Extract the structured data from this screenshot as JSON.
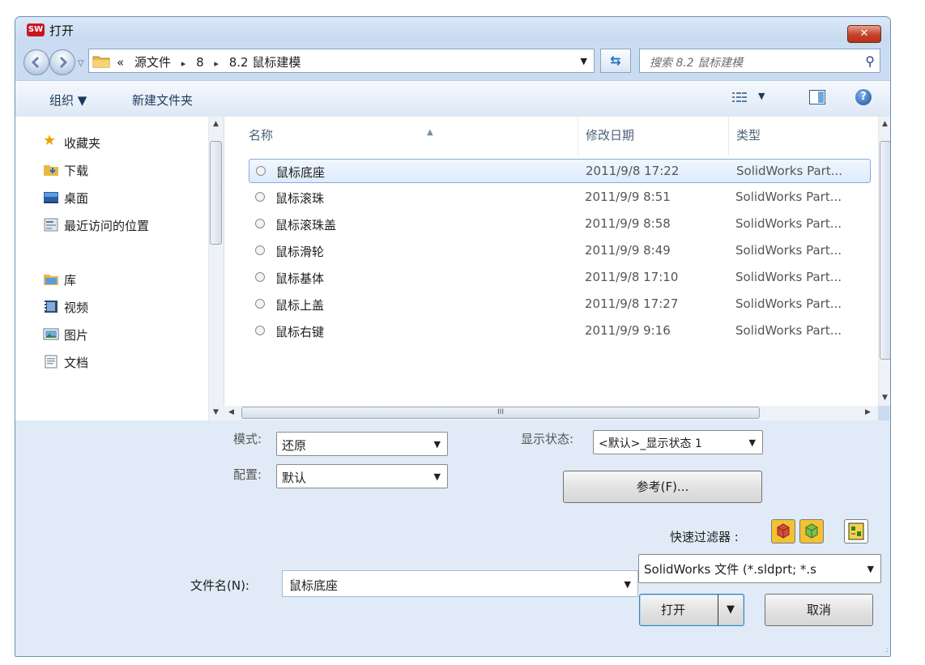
{
  "window": {
    "title": "打开",
    "close_label": "✕",
    "logo_text": "SW"
  },
  "nav": {
    "breadcrumbs": [
      "«",
      "源文件",
      "▸",
      "8",
      "▸",
      "8.2 鼠标建模"
    ],
    "search_placeholder": "搜索 8.2 鼠标建模"
  },
  "toolbar": {
    "organize": "组织 ▼",
    "new_folder": "新建文件夹"
  },
  "sidebar": {
    "items": [
      {
        "label": "收藏夹",
        "icon": "star-icon"
      },
      {
        "label": "下载",
        "icon": "download-folder-icon"
      },
      {
        "label": "桌面",
        "icon": "desktop-icon"
      },
      {
        "label": "最近访问的位置",
        "icon": "recent-places-icon"
      },
      {
        "label": "库",
        "icon": "library-icon"
      },
      {
        "label": "视频",
        "icon": "video-icon"
      },
      {
        "label": "图片",
        "icon": "pictures-icon"
      },
      {
        "label": "文档",
        "icon": "documents-icon"
      }
    ]
  },
  "files": {
    "columns": [
      "名称",
      "修改日期",
      "类型"
    ],
    "rows": [
      {
        "name": "鼠标底座",
        "date": "2011/9/8 17:22",
        "type": "SolidWorks Part..."
      },
      {
        "name": "鼠标滚珠",
        "date": "2011/9/9 8:51",
        "type": "SolidWorks Part..."
      },
      {
        "name": "鼠标滚珠盖",
        "date": "2011/9/9 8:58",
        "type": "SolidWorks Part..."
      },
      {
        "name": "鼠标滑轮",
        "date": "2011/9/9 8:49",
        "type": "SolidWorks Part..."
      },
      {
        "name": "鼠标基体",
        "date": "2011/9/8 17:10",
        "type": "SolidWorks Part..."
      },
      {
        "name": "鼠标上盖",
        "date": "2011/9/8 17:27",
        "type": "SolidWorks Part..."
      },
      {
        "name": "鼠标右键",
        "date": "2011/9/9 9:16",
        "type": "SolidWorks Part..."
      }
    ],
    "scroll_grip": "III"
  },
  "options": {
    "mode_label": "模式:",
    "mode_value": "还原",
    "config_label": "配置:",
    "config_value": "默认",
    "display_state_label": "显示状态:",
    "display_state_value": "<默认>_显示状态 1",
    "references_button": "参考(F)...",
    "quick_filter_label": "快速过滤器 :"
  },
  "footer": {
    "filename_label": "文件名(N):",
    "filename_value": "鼠标底座",
    "filetype_value": "SolidWorks 文件 (*.sldprt; *.s",
    "open_button": "打开",
    "cancel_button": "取消"
  }
}
